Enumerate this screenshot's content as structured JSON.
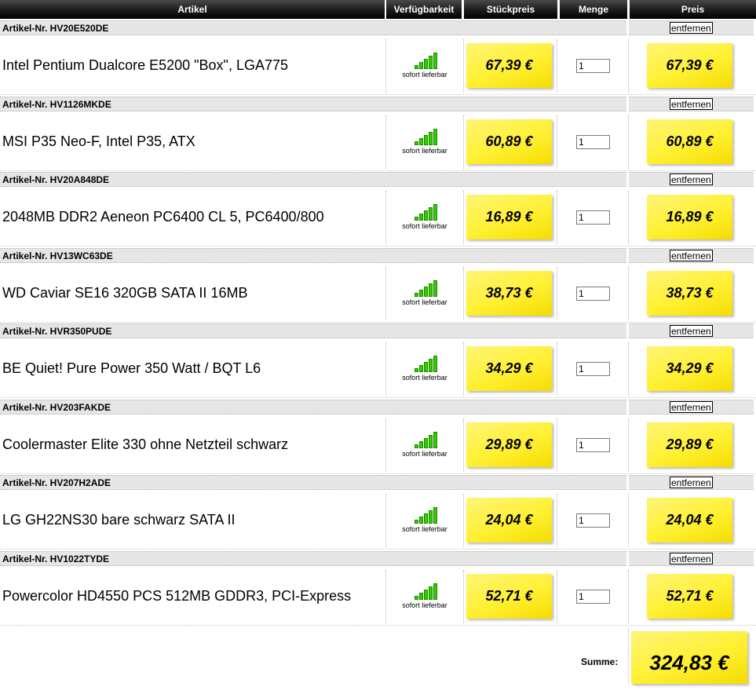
{
  "header": {
    "col_artikel": "Artikel",
    "col_verfuegbarkeit": "Verfügbarkeit",
    "col_stueckpreis": "Stückpreis",
    "col_menge": "Menge",
    "col_preis": "Preis"
  },
  "remove_label": "entfernen",
  "items": [
    {
      "art_nr": "Artikel-Nr. HV20E520DE",
      "name": "Intel Pentium Dualcore E5200 \"Box\", LGA775",
      "availability": "sofort lieferbar",
      "unit_price": "67,39 €",
      "quantity": "1",
      "total": "67,39 €"
    },
    {
      "art_nr": "Artikel-Nr. HV1126MKDE",
      "name": "MSI P35 Neo-F, Intel P35, ATX",
      "availability": "sofort lieferbar",
      "unit_price": "60,89 €",
      "quantity": "1",
      "total": "60,89 €"
    },
    {
      "art_nr": "Artikel-Nr. HV20A848DE",
      "name": "2048MB DDR2 Aeneon PC6400 CL 5, PC6400/800",
      "availability": "sofort lieferbar",
      "unit_price": "16,89 €",
      "quantity": "1",
      "total": "16,89 €"
    },
    {
      "art_nr": "Artikel-Nr. HV13WC63DE",
      "name": "WD Caviar SE16 320GB SATA II 16MB",
      "availability": "sofort lieferbar",
      "unit_price": "38,73 €",
      "quantity": "1",
      "total": "38,73 €"
    },
    {
      "art_nr": "Artikel-Nr. HVR350PUDE",
      "name": "BE Quiet! Pure Power 350 Watt / BQT L6",
      "availability": "sofort lieferbar",
      "unit_price": "34,29 €",
      "quantity": "1",
      "total": "34,29 €"
    },
    {
      "art_nr": "Artikel-Nr. HV203FAKDE",
      "name": "Coolermaster Elite 330 ohne Netzteil schwarz",
      "availability": "sofort lieferbar",
      "unit_price": "29,89 €",
      "quantity": "1",
      "total": "29,89 €"
    },
    {
      "art_nr": "Artikel-Nr. HV207H2ADE",
      "name": "LG GH22NS30 bare schwarz SATA II",
      "availability": "sofort lieferbar",
      "unit_price": "24,04 €",
      "quantity": "1",
      "total": "24,04 €"
    },
    {
      "art_nr": "Artikel-Nr. HV1022TYDE",
      "name": "Powercolor HD4550 PCS 512MB GDDR3, PCI-Express",
      "availability": "sofort lieferbar",
      "unit_price": "52,71 €",
      "quantity": "1",
      "total": "52,71 €"
    }
  ],
  "summary": {
    "label": "Summe:",
    "total": "324,83 €"
  },
  "icons": {
    "availability": "signal-bars-icon"
  },
  "colors": {
    "availability_green": "#33cc00",
    "note_yellow": "#fff032",
    "row_gray": "#e6e6e6"
  }
}
